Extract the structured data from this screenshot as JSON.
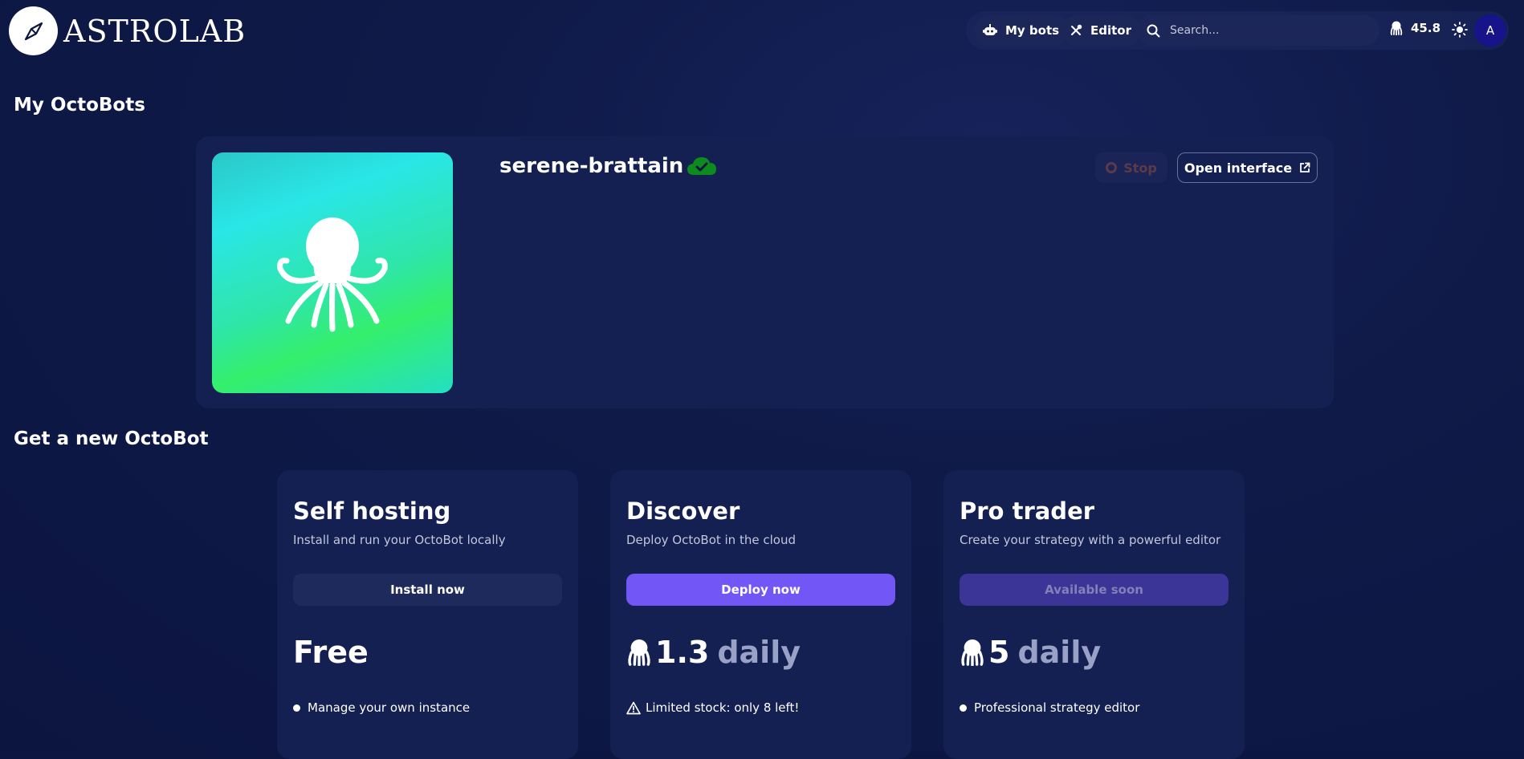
{
  "header": {
    "logo_text": "ASTROLAB",
    "nav": {
      "my_bots_label": "My bots",
      "editor_label": "Editor",
      "search_placeholder": "Search...",
      "credits": "45.8",
      "avatar_letter": "A"
    }
  },
  "my_octobots": {
    "title": "My OctoBots",
    "bot": {
      "name": "serene-brattain",
      "status_icon": "cloud-check-icon",
      "stop_label": "Stop",
      "open_interface_label": "Open interface"
    }
  },
  "new_octobot": {
    "title": "Get a new OctoBot",
    "plans": [
      {
        "title": "Self hosting",
        "subtitle": "Install and run your OctoBot locally",
        "button_label": "Install now",
        "price": "Free",
        "price_unit": "",
        "feature": "Manage your own instance"
      },
      {
        "title": "Discover",
        "subtitle": "Deploy OctoBot in the cloud",
        "button_label": "Deploy now",
        "price": "1.3",
        "price_unit": "daily",
        "feature": "Limited stock: only 8 left!"
      },
      {
        "title": "Pro trader",
        "subtitle": "Create your strategy with a powerful editor",
        "button_label": "Available soon",
        "price": "5",
        "price_unit": "daily",
        "feature": "Professional strategy editor"
      }
    ]
  },
  "colors": {
    "background": "#0d1640",
    "card": "#141f52",
    "accent_purple": "#7357f6",
    "disabled_purple": "#3a3596",
    "status_green": "#0f8a1e"
  }
}
